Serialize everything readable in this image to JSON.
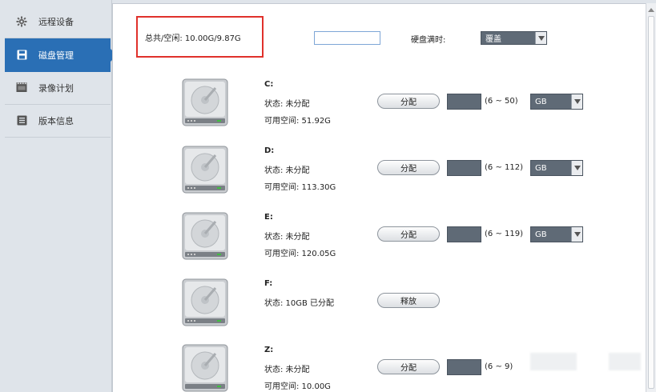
{
  "sidebar": {
    "items": [
      {
        "label": "远程设备",
        "icon": "gear-icon"
      },
      {
        "label": "磁盘管理",
        "icon": "floppy-disk-icon"
      },
      {
        "label": "录像计划",
        "icon": "film-icon"
      },
      {
        "label": "版本信息",
        "icon": "list-icon"
      }
    ],
    "active_index": 1
  },
  "header": {
    "capacity_text": "总共/空闲: 10.00G/9.87G",
    "overflow_input_value": "",
    "full_label": "硬盘满时:",
    "full_select": "覆盖"
  },
  "drives": [
    {
      "name": "C:",
      "status": "状态: 未分配",
      "free": "可用空间: 51.92G",
      "button": "分配",
      "range": "(6 ~ 50)",
      "unit": "GB"
    },
    {
      "name": "D:",
      "status": "状态: 未分配",
      "free": "可用空间: 113.30G",
      "button": "分配",
      "range": "(6 ~ 112)",
      "unit": "GB"
    },
    {
      "name": "E:",
      "status": "状态: 未分配",
      "free": "可用空间: 120.05G",
      "button": "分配",
      "range": "(6 ~ 119)",
      "unit": "GB"
    },
    {
      "name": "F:",
      "status": "状态: 10GB 已分配",
      "free": "",
      "button": "释放",
      "range": "",
      "unit": ""
    },
    {
      "name": "Z:",
      "status": "状态: 未分配",
      "free": "可用空间: 10.00G",
      "button": "分配",
      "range": "(6 ~ 9)",
      "unit": ""
    }
  ],
  "colors": {
    "accent": "#2a6fb5",
    "highlight_border": "#e0312b",
    "select_bg": "#5f6a76"
  }
}
